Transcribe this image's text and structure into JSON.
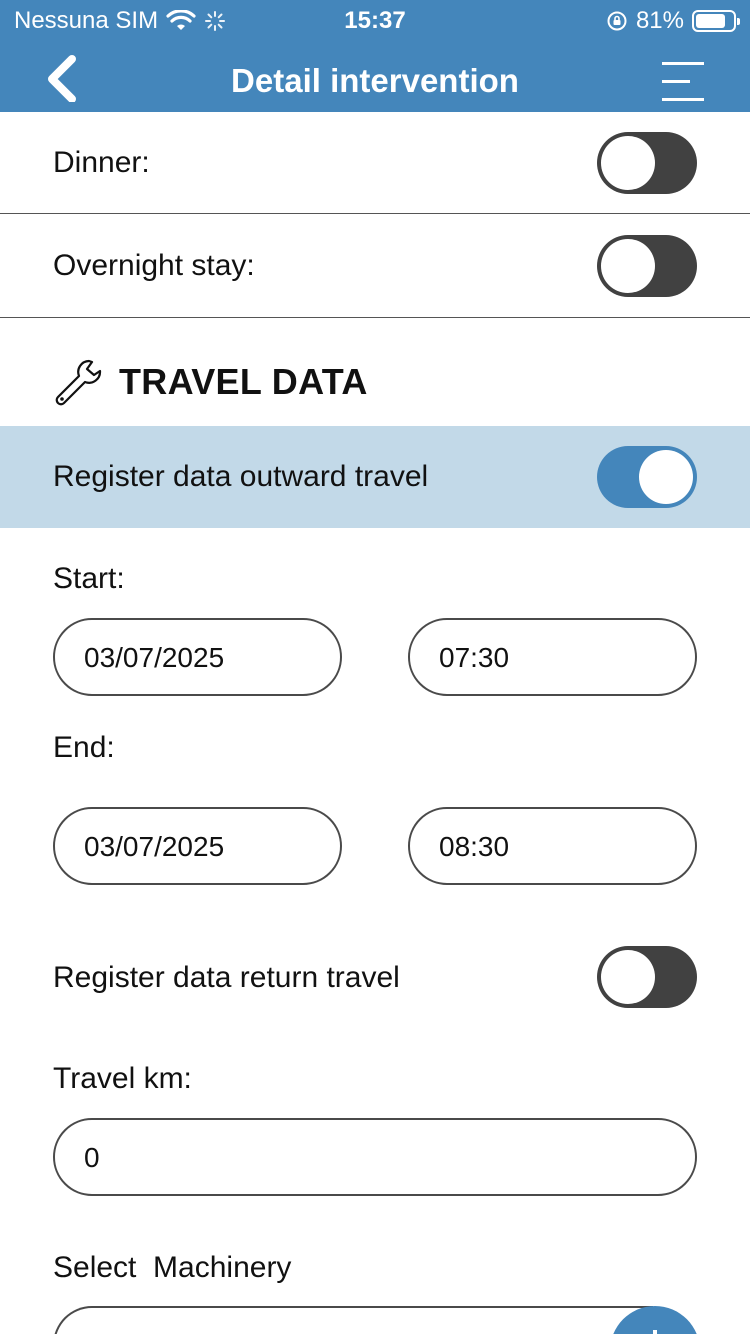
{
  "status_bar": {
    "carrier": "Nessuna SIM",
    "time": "15:37",
    "battery": "81%",
    "battery_level": 0.81
  },
  "nav": {
    "title": "Detail intervention",
    "back_icon": "chevron-left-icon",
    "menu_icon": "menu-icon"
  },
  "toggles": {
    "dinner": {
      "label": "Dinner:",
      "on": false
    },
    "overnight": {
      "label": "Overnight stay:",
      "on": false
    },
    "outward": {
      "label": "Register data outward travel",
      "on": true
    },
    "return": {
      "label": "Register data return travel",
      "on": false
    }
  },
  "section": {
    "title": "TRAVEL DATA",
    "icon": "wrench-icon"
  },
  "start": {
    "label": "Start:",
    "date": "03/07/2025",
    "time": "07:30"
  },
  "end": {
    "label": "End:",
    "date": "03/07/2025",
    "time": "08:30"
  },
  "travel_km": {
    "label": "Travel km:",
    "value": "0"
  },
  "machinery": {
    "label": "Select  Machinery"
  },
  "colors": {
    "accent": "#4486bb",
    "highlight": "#c2d9e8",
    "toggle_off": "#414141"
  }
}
